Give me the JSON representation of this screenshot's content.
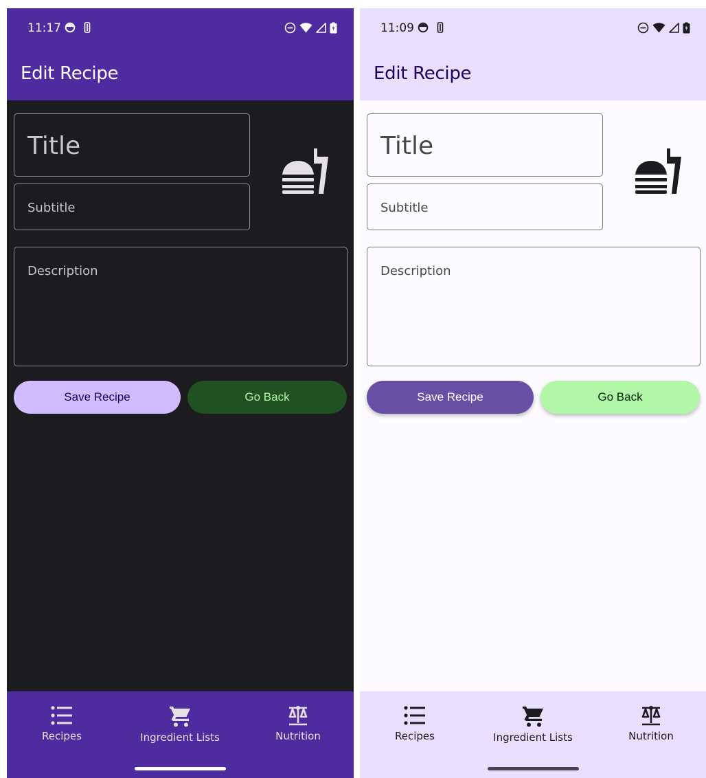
{
  "screens": [
    {
      "theme": "dark",
      "status_bar": {
        "time": "11:17"
      },
      "app_bar": {
        "title": "Edit Recipe"
      },
      "form": {
        "title_placeholder": "Title",
        "subtitle_placeholder": "Subtitle",
        "description_placeholder": "Description"
      },
      "buttons": {
        "save": "Save Recipe",
        "back": "Go Back"
      },
      "nav": [
        {
          "label": "Recipes",
          "icon": "list-icon"
        },
        {
          "label": "Ingredient Lists",
          "icon": "cart-icon"
        },
        {
          "label": "Nutrition",
          "icon": "scale-icon"
        }
      ],
      "colors": {
        "bar": "#4f2ba0",
        "background": "#1c1b1f",
        "save_bg": "#d0bcff",
        "back_bg": "#215022"
      }
    },
    {
      "theme": "light",
      "status_bar": {
        "time": "11:09"
      },
      "app_bar": {
        "title": "Edit Recipe"
      },
      "form": {
        "title_placeholder": "Title",
        "subtitle_placeholder": "Subtitle",
        "description_placeholder": "Description"
      },
      "buttons": {
        "save": "Save Recipe",
        "back": "Go Back"
      },
      "nav": [
        {
          "label": "Recipes",
          "icon": "list-icon"
        },
        {
          "label": "Ingredient Lists",
          "icon": "cart-icon"
        },
        {
          "label": "Nutrition",
          "icon": "scale-icon"
        }
      ],
      "colors": {
        "bar": "#e8defd",
        "background": "#fdfbff",
        "save_bg": "#6750a4",
        "back_bg": "#b1f7a7"
      }
    }
  ]
}
